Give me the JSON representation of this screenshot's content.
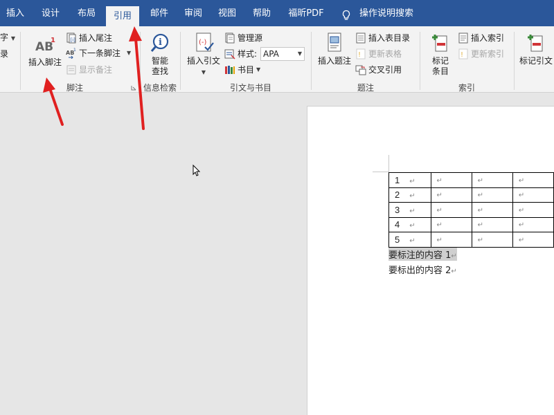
{
  "tabs": [
    {
      "label": "插入",
      "active": false
    },
    {
      "label": "设计",
      "active": false
    },
    {
      "label": "布局",
      "active": false
    },
    {
      "label": "引用",
      "active": true
    },
    {
      "label": "邮件",
      "active": false
    },
    {
      "label": "审阅",
      "active": false
    },
    {
      "label": "视图",
      "active": false
    },
    {
      "label": "帮助",
      "active": false
    },
    {
      "label": "福昕PDF",
      "active": false
    }
  ],
  "tellme": {
    "label": "操作说明搜索",
    "icon": "lightbulb-icon"
  },
  "ribbon": {
    "partial_left": {
      "line1": "字",
      "line2": "录"
    },
    "footnotes": {
      "group_label": "脚注",
      "insert_footnote": "插入脚注",
      "insert_footnote_icon_text": "AB",
      "insert_footnote_sup": "1",
      "insert_endnote": "插入尾注",
      "next_footnote": "下一条脚注",
      "next_footnote_icon_text": "AB",
      "show_notes": "显示备注"
    },
    "research": {
      "group_label": "信息检索",
      "smart_lookup_line1": "智能",
      "smart_lookup_line2": "查找"
    },
    "citations": {
      "group_label": "引文与书目",
      "insert_citation": "插入引文",
      "manage_sources": "管理源",
      "style_label": "样式:",
      "style_value": "APA",
      "bibliography": "书目"
    },
    "captions": {
      "group_label": "题注",
      "insert_caption": "插入题注",
      "insert_table_of_figures": "插入表目录",
      "update_table": "更新表格",
      "cross_reference": "交叉引用"
    },
    "index": {
      "group_label": "索引",
      "mark_entry_line1": "标记",
      "mark_entry_line2": "条目",
      "insert_index": "插入索引",
      "update_index": "更新索引"
    },
    "mark_citation": {
      "label": "标记引文"
    }
  },
  "document": {
    "table_rows": [
      "1",
      "2",
      "3",
      "4",
      "5"
    ],
    "cell_mark": "↵",
    "lines": [
      {
        "text": "要标注的内容 1",
        "selected": true
      },
      {
        "text": "要标出的内容 2",
        "selected": false
      }
    ]
  },
  "colors": {
    "brand": "#2b579a",
    "arrow": "#e02020",
    "ribbon_bg": "#f3f3f3"
  }
}
